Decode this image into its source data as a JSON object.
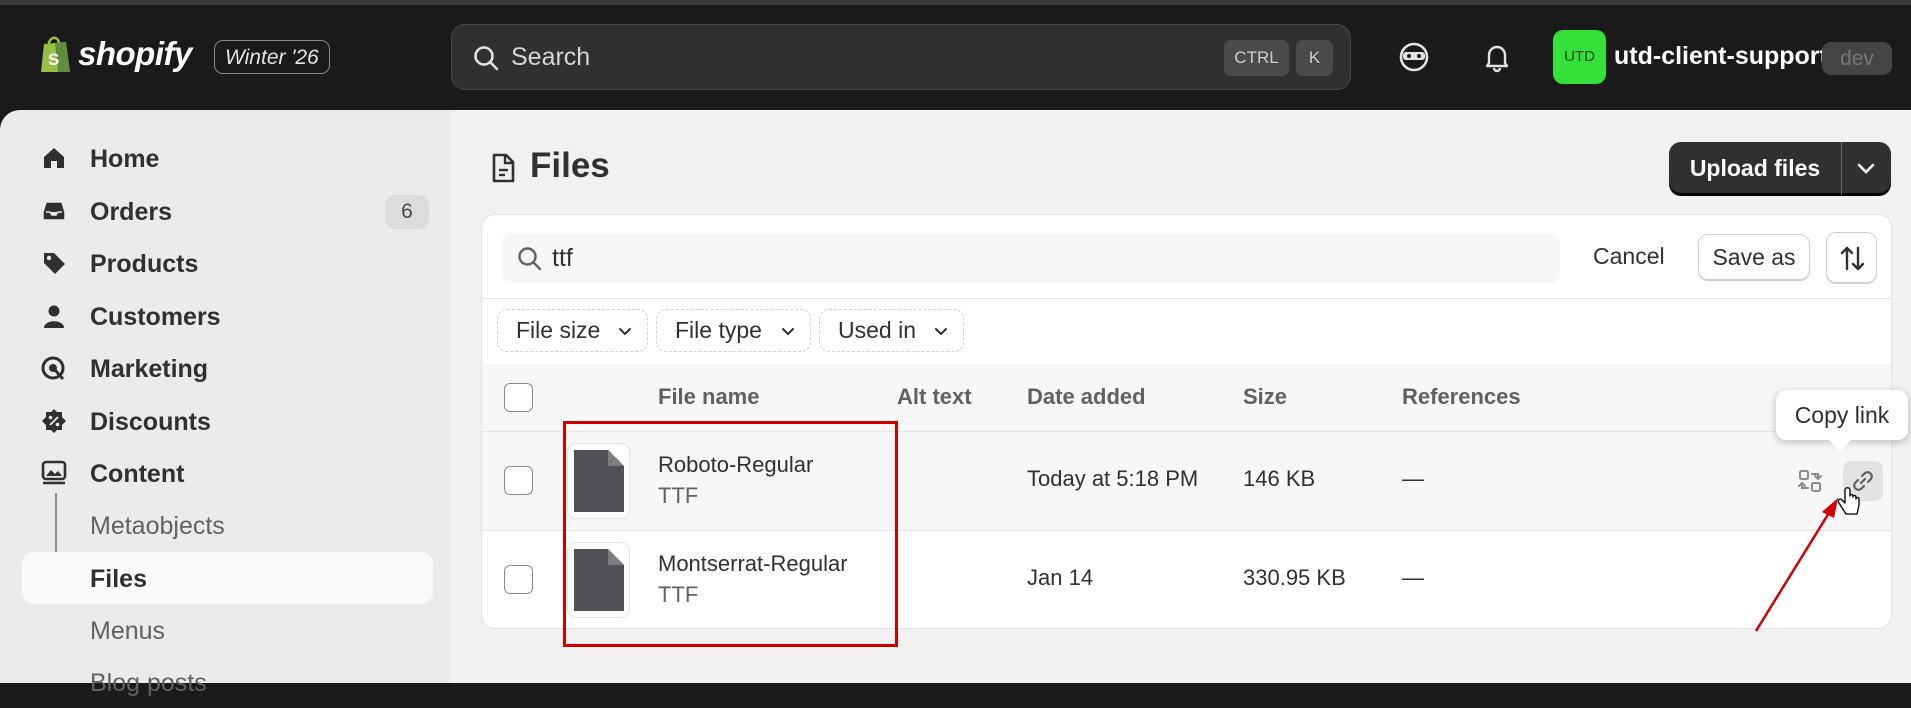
{
  "brand": {
    "name": "shopify",
    "edition": "Winter '26"
  },
  "search": {
    "placeholder": "Search",
    "shortcut_ctrl": "CTRL",
    "shortcut_k": "K"
  },
  "store": {
    "avatar_initials": "UTD",
    "name": "utd-client-support",
    "badge": "dev",
    "avatar_color": "#36e03a"
  },
  "sidebar": {
    "items": [
      {
        "label": "Home",
        "icon": "home-icon"
      },
      {
        "label": "Orders",
        "icon": "inbox-icon",
        "badge": "6"
      },
      {
        "label": "Products",
        "icon": "tag-icon"
      },
      {
        "label": "Customers",
        "icon": "person-icon"
      },
      {
        "label": "Marketing",
        "icon": "target-icon"
      },
      {
        "label": "Discounts",
        "icon": "discount-icon"
      },
      {
        "label": "Content",
        "icon": "image-icon"
      }
    ],
    "subitems": [
      {
        "label": "Metaobjects"
      },
      {
        "label": "Files",
        "active": true
      },
      {
        "label": "Menus"
      },
      {
        "label": "Blog posts"
      }
    ]
  },
  "page": {
    "title": "Files",
    "upload_label": "Upload files"
  },
  "filters": {
    "query": "ttf",
    "cancel_label": "Cancel",
    "saveas_label": "Save as",
    "chips": [
      "File size",
      "File type",
      "Used in"
    ]
  },
  "table": {
    "headers": [
      "File name",
      "Alt text",
      "Date added",
      "Size",
      "References"
    ],
    "rows": [
      {
        "name": "Roboto-Regular",
        "type": "TTF",
        "alt": "",
        "date": "Today at 5:18 PM",
        "size": "146 KB",
        "references": "—"
      },
      {
        "name": "Montserrat-Regular",
        "type": "TTF",
        "alt": "",
        "date": "Jan 14",
        "size": "330.95 KB",
        "references": "—"
      }
    ]
  },
  "tooltip": {
    "text": "Copy link"
  },
  "annotation_color": "#d00000"
}
